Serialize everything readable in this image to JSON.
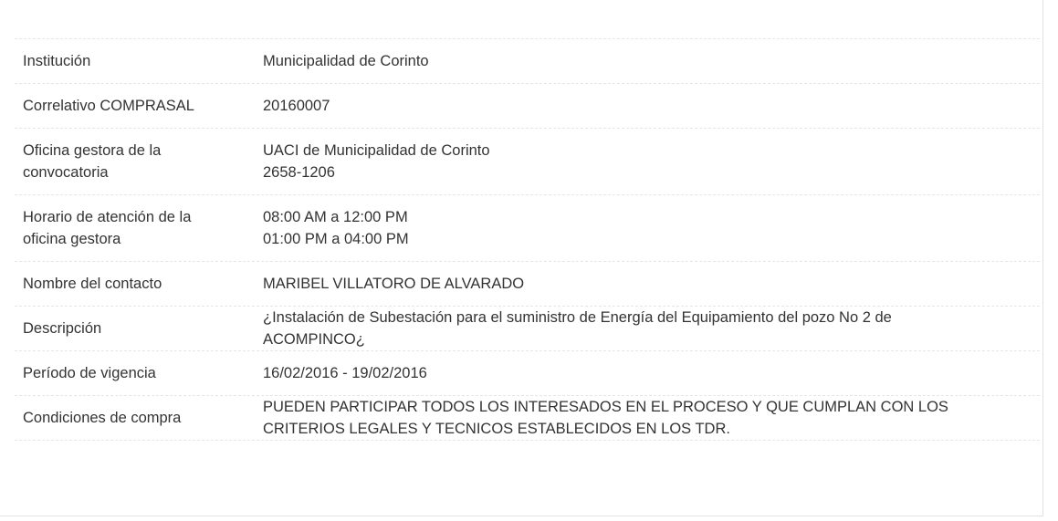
{
  "rows": [
    {
      "label": "Institución",
      "lines": [
        "Municipalidad de Corinto"
      ]
    },
    {
      "label": "Correlativo COMPRASAL",
      "lines": [
        "20160007"
      ]
    },
    {
      "label": "Oficina gestora de la convocatoria",
      "lines": [
        "UACI de Municipalidad de Corinto",
        "2658-1206"
      ]
    },
    {
      "label": "Horario de atención de la oficina gestora",
      "lines": [
        "08:00 AM a 12:00 PM",
        "01:00 PM a 04:00 PM"
      ]
    },
    {
      "label": "Nombre del contacto",
      "lines": [
        "MARIBEL VILLATORO DE ALVARADO"
      ]
    },
    {
      "label": "Descripción",
      "lines": [
        "¿Instalación de Subestación para el suministro de Energía del Equipamiento del pozo No 2 de ACOMPINCO¿"
      ]
    },
    {
      "label": "Período de vigencia",
      "lines": [
        "16/02/2016 - 19/02/2016"
      ]
    },
    {
      "label": "Condiciones de compra",
      "lines": [
        "PUEDEN PARTICIPAR TODOS LOS INTERESADOS EN EL PROCESO Y QUE CUMPLAN CON LOS CRITERIOS LEGALES Y TECNICOS ESTABLECIDOS EN LOS TDR."
      ]
    }
  ]
}
